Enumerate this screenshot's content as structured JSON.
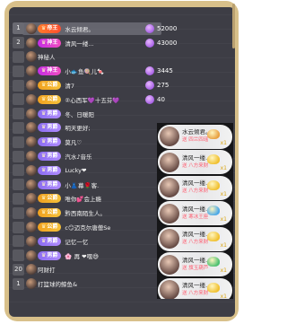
{
  "ranking": [
    {
      "rank": "1",
      "badge": "帝王",
      "badge_type": "dw",
      "name": "水云倾君。",
      "value": "52000",
      "highlight": true
    },
    {
      "rank": "2",
      "badge": "神王",
      "badge_type": "sw",
      "name": "清风一缕...",
      "value": "43000",
      "highlight": false
    },
    {
      "rank": "",
      "badge": "",
      "badge_type": "",
      "name": "神秘人",
      "value": "",
      "highlight": false
    },
    {
      "rank": "",
      "badge": "神王",
      "badge_type": "sw",
      "name": "小🐟鱼🍭儿🍬",
      "value": "3445",
      "highlight": false
    },
    {
      "rank": "",
      "badge": "公爵",
      "badge_type": "gj",
      "name": "清7",
      "value": "275",
      "highlight": false
    },
    {
      "rank": "",
      "badge": "公爵",
      "badge_type": "gj",
      "name": "②心西军💜十五芬💜",
      "value": "40",
      "highlight": false
    },
    {
      "rank": "",
      "badge": "男爵",
      "badge_type": "hj",
      "name": "冬、日暖阳",
      "value": "",
      "highlight": false
    },
    {
      "rank": "",
      "badge": "男爵",
      "badge_type": "hj",
      "name": "明天更好;",
      "value": "",
      "highlight": false
    },
    {
      "rank": "",
      "badge": "男爵",
      "badge_type": "hj",
      "name": "莫凡♡",
      "value": "",
      "highlight": false
    },
    {
      "rank": "",
      "badge": "男爵",
      "badge_type": "hj",
      "name": "汽水♪音乐",
      "value": "",
      "highlight": false
    },
    {
      "rank": "",
      "badge": "男爵",
      "badge_type": "hj",
      "name": "Lucky❤",
      "value": "",
      "highlight": false
    },
    {
      "rank": "",
      "badge": "男爵",
      "badge_type": "hj",
      "name": "小👗幕🌹客.",
      "value": "",
      "highlight": false
    },
    {
      "rank": "",
      "badge": "公爵",
      "badge_type": "gj",
      "name": "唯你💕会上瘾",
      "value": "",
      "highlight": false
    },
    {
      "rank": "",
      "badge": "公爵",
      "badge_type": "gj",
      "name": "黔西南陌生人。",
      "value": "",
      "highlight": false
    },
    {
      "rank": "",
      "badge": "公爵",
      "badge_type": "gj",
      "name": "c😏迈克尔唐僧Se",
      "value": "",
      "highlight": false
    },
    {
      "rank": "",
      "badge": "男爵",
      "badge_type": "hj",
      "name": "记忆一忆",
      "value": "",
      "highlight": false
    },
    {
      "rank": "",
      "badge": "男爵",
      "badge_type": "hj",
      "name": "🌸 再 ❤嘿😅",
      "value": "",
      "highlight": false
    },
    {
      "rank": "20",
      "badge": "",
      "badge_type": "",
      "name": "阿财打",
      "value": "",
      "highlight": false
    },
    {
      "rank": "1",
      "badge": "",
      "badge_type": "",
      "name": "打篮球的鲸鱼&",
      "value": "",
      "highlight": false
    }
  ],
  "gifts": [
    {
      "name": "水云倾君。",
      "send": "送 四兰四瑶",
      "count": "x1",
      "color": "#e8a040"
    },
    {
      "name": "清风一缕...",
      "send": "送 八方来财",
      "count": "x1",
      "color": "#f0c030"
    },
    {
      "name": "清风一缕...",
      "send": "送 八方来财",
      "count": "x1",
      "color": "#f0c030"
    },
    {
      "name": "清风一缕...",
      "send": "送 寒冰王座",
      "count": "x1",
      "color": "#4aa8e8"
    },
    {
      "name": "清风一缕...",
      "send": "送 八方来财",
      "count": "x1",
      "color": "#f0c030"
    },
    {
      "name": "清风一缕...",
      "send": "送 旗玉葫芦",
      "count": "x1",
      "color": "#4cc070"
    },
    {
      "name": "清风一缕...",
      "send": "送 八方来财",
      "count": "x1",
      "color": "#f0c030"
    }
  ]
}
